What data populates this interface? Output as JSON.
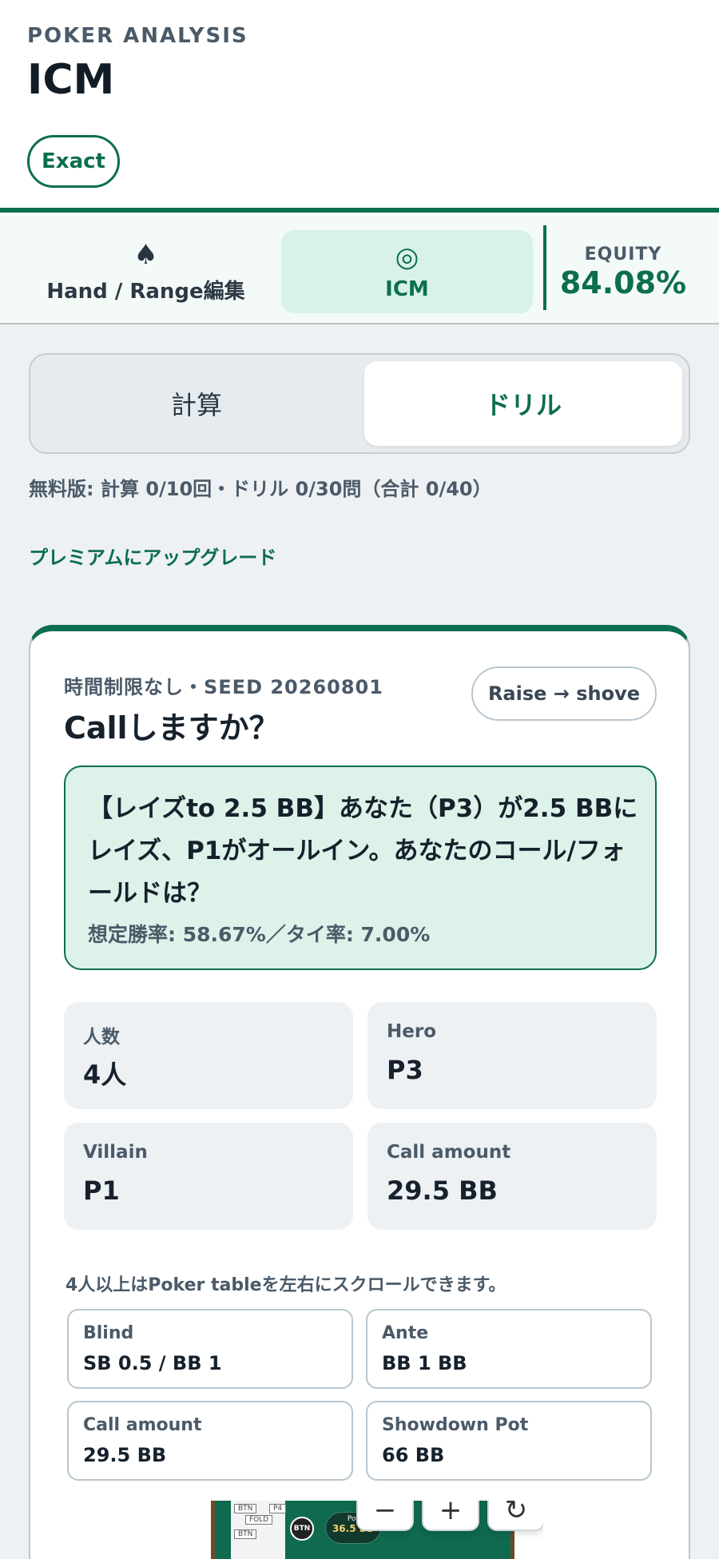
{
  "header": {
    "eyebrow": "POKER ANALYSIS",
    "title": "ICM",
    "mode_badge": "Exact"
  },
  "tabs": [
    {
      "label": "Hand / Range編集",
      "icon": "spade-icon",
      "glyph": "♠",
      "active": false
    },
    {
      "label": "ICM",
      "icon": "target-icon",
      "glyph": "◎",
      "active": true
    }
  ],
  "equity": {
    "label": "EQUITY",
    "value": "84.08%"
  },
  "mode_switch": {
    "calc_label": "計算",
    "drill_label": "ドリル",
    "selected": "ドリル"
  },
  "usage_text": "無料版: 計算 0/10回・ドリル 0/30問（合計 0/40）",
  "upgrade_link": "プレミアムにアップグレード",
  "drill": {
    "meta": "時間制限なし・SEED 20260801",
    "question": "Callしますか？",
    "action_badge": "Raise → shove",
    "scenario": "【レイズto 2.5 BB】あなた（P3）が2.5 BBにレイズ、P1がオールイン。あなたのコール/フォールドは？",
    "scenario_sub": "想定勝率: 58.67%／タイ率: 7.00%",
    "stats": [
      {
        "label": "人数",
        "value": "4人"
      },
      {
        "label": "Hero",
        "value": "P3"
      },
      {
        "label": "Villain",
        "value": "P1"
      },
      {
        "label": "Call amount",
        "value": "29.5 BB"
      }
    ],
    "hint": "4人以上はPoker tableを左右にスクロールできます。",
    "info": [
      {
        "label": "Blind",
        "value": "SB 0.5 / BB 1"
      },
      {
        "label": "Ante",
        "value": "BB 1 BB"
      },
      {
        "label": "Call amount",
        "value": "29.5 BB"
      },
      {
        "label": "Showdown Pot",
        "value": "66 BB"
      }
    ]
  },
  "table_preview": {
    "seat_tags": [
      "BTN",
      "FOLD",
      "BTN",
      "P4"
    ],
    "dealer_button": "BTN",
    "pot_label": "Pot",
    "pot_value": "36.5 BB",
    "zoom_buttons": [
      "−",
      "+",
      "↻"
    ]
  },
  "colors": {
    "accent": "#0c6e50",
    "accent_soft": "#d9f2e7",
    "background": "#eef1f4"
  }
}
